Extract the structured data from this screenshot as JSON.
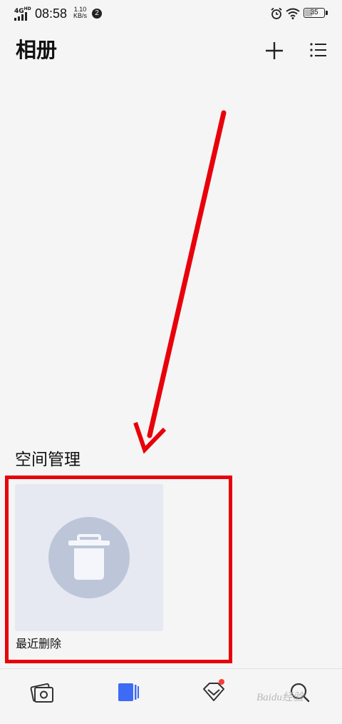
{
  "status_bar": {
    "network": "4G",
    "network_sup": "HD",
    "time": "08:58",
    "speed_value": "1.10",
    "speed_unit": "KB/s",
    "notification_count": "2",
    "battery_level": "35"
  },
  "header": {
    "title": "相册",
    "add_icon": "plus-icon",
    "menu_icon": "list-icon"
  },
  "space_management": {
    "title": "空间管理",
    "items": [
      {
        "label": "最近删除",
        "icon": "trash-icon"
      }
    ]
  },
  "bottom_nav": {
    "items": [
      {
        "icon": "photos-icon",
        "active": false
      },
      {
        "icon": "albums-icon",
        "active": true
      },
      {
        "icon": "discover-icon",
        "active": false,
        "badge": true
      },
      {
        "icon": "search-icon",
        "active": false
      }
    ]
  },
  "watermark": "Baidu经验",
  "colors": {
    "accent": "#3d6bf5",
    "annotation": "#e8000b",
    "card_bg": "#e6e9f2",
    "trash_circle": "#bcc6d8"
  }
}
